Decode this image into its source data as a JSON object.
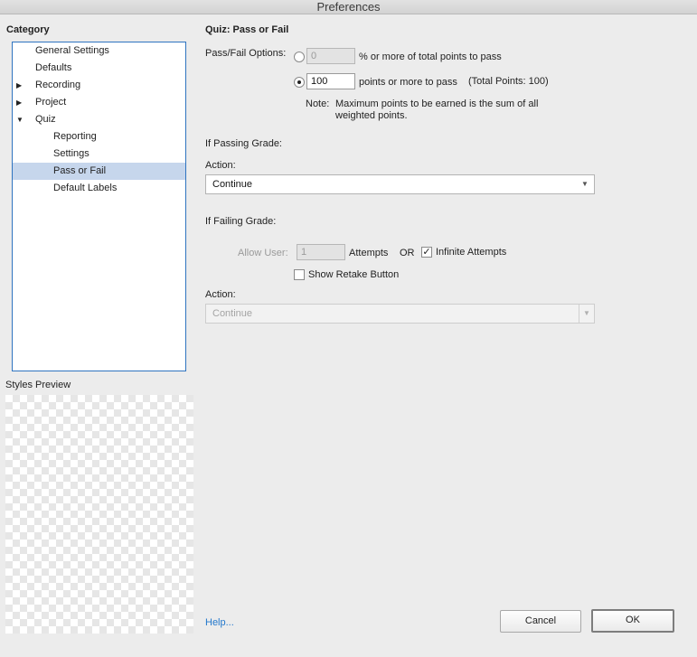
{
  "window": {
    "title": "Preferences"
  },
  "sidebar": {
    "heading": "Category",
    "items": [
      {
        "label": "General Settings",
        "expander": ""
      },
      {
        "label": "Defaults",
        "expander": ""
      },
      {
        "label": "Recording",
        "expander": "▶"
      },
      {
        "label": "Project",
        "expander": "▶"
      },
      {
        "label": "Quiz",
        "expander": "▼"
      },
      {
        "label": "Reporting",
        "expander": ""
      },
      {
        "label": "Settings",
        "expander": ""
      },
      {
        "label": "Pass or Fail",
        "expander": "",
        "selected": true
      },
      {
        "label": "Default Labels",
        "expander": ""
      }
    ],
    "preview_label": "Styles Preview"
  },
  "main": {
    "title": "Quiz: Pass or Fail",
    "passfail": {
      "label": "Pass/Fail Options:",
      "percent_value": "0",
      "percent_text": "% or more of total points to pass",
      "points_value": "100",
      "points_text": "points or more to pass",
      "total_text": "(Total Points: 100)",
      "note_label": "Note:",
      "note_line1": "Maximum points to be earned is the sum of all",
      "note_line2": "weighted points."
    },
    "passing": {
      "heading": "If Passing Grade:",
      "action_label": "Action:",
      "action_value": "Continue"
    },
    "failing": {
      "heading": "If Failing Grade:",
      "allow_label": "Allow User:",
      "attempts_value": "1",
      "attempts_text": "Attempts",
      "or_text": "OR",
      "infinite_label": "Infinite Attempts",
      "retake_label": "Show Retake Button",
      "action_label": "Action:",
      "action_value": "Continue"
    }
  },
  "footer": {
    "help_label": "Help...",
    "cancel_label": "Cancel",
    "ok_label": "OK"
  },
  "icons": {
    "collapsed": "chevron-right-icon",
    "expanded": "chevron-down-icon",
    "dropdown": "caret-down-icon",
    "check": "checkmark-icon"
  }
}
